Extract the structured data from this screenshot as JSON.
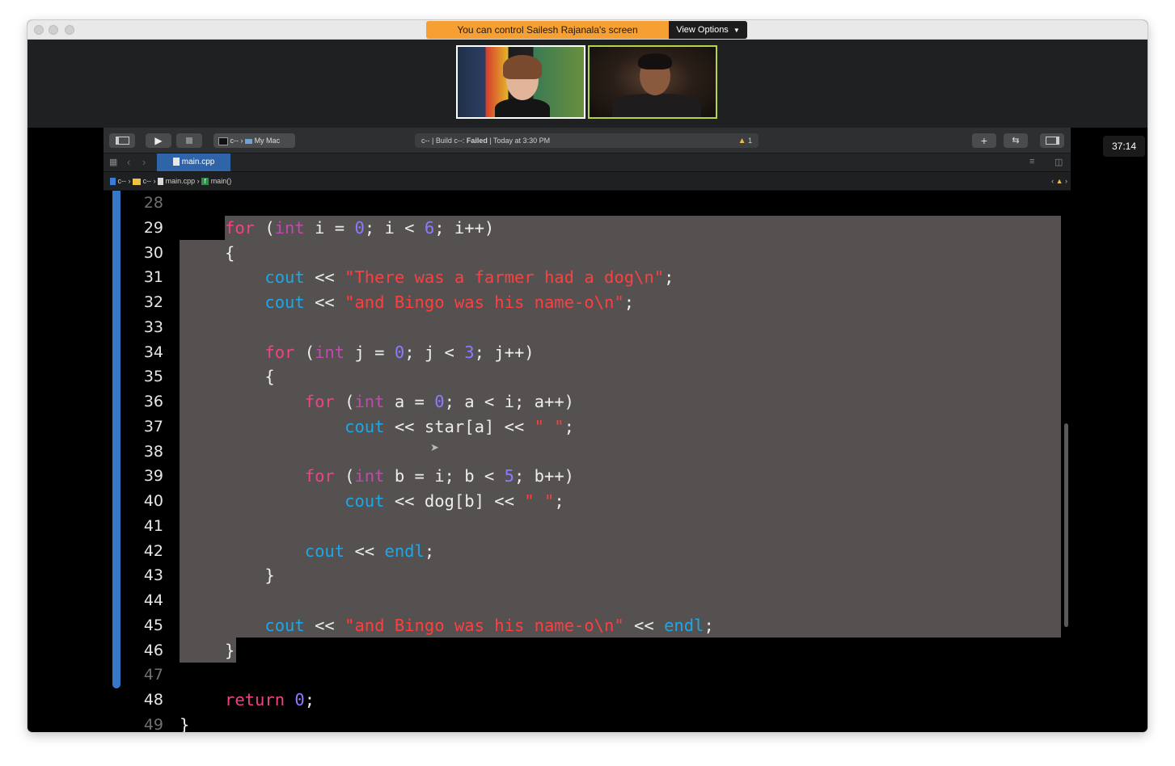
{
  "zoom": {
    "banner": "You can control Sailesh Rajanala's screen",
    "view_options": "View Options",
    "timer": "37:14"
  },
  "xcode": {
    "scheme": "c--",
    "destination": "My Mac",
    "status_prefix": "c-- | Build c--: ",
    "status_result": "Failed",
    "status_time": " | Today at 3:30 PM",
    "warning_count": "1",
    "tab_label": "main.cpp",
    "breadcrumb": [
      "c--",
      "c--",
      "main.cpp",
      "main()"
    ],
    "selection_color": "#545150",
    "accent_color": "#3478c6"
  },
  "code_lines": [
    {
      "n": "28",
      "code": []
    },
    {
      "n": "29",
      "code": [
        [
          "for",
          "kw"
        ],
        [
          " (",
          ""
        ],
        [
          "int",
          "ty"
        ],
        [
          " i = ",
          ""
        ],
        [
          "0",
          "num"
        ],
        [
          "; i < ",
          ""
        ],
        [
          "6",
          "num"
        ],
        [
          "; i++)",
          ""
        ]
      ]
    },
    {
      "n": "30",
      "code": [
        [
          "{",
          ""
        ]
      ]
    },
    {
      "n": "31",
      "code": [
        [
          "    ",
          ""
        ],
        [
          "cout",
          "fn"
        ],
        [
          " << ",
          ""
        ],
        [
          "\"There was a farmer had a dog\\n\"",
          "str"
        ],
        [
          ";",
          ""
        ]
      ]
    },
    {
      "n": "32",
      "code": [
        [
          "    ",
          ""
        ],
        [
          "cout",
          "fn"
        ],
        [
          " << ",
          ""
        ],
        [
          "\"and Bingo was his name-o\\n\"",
          "str"
        ],
        [
          ";",
          ""
        ]
      ]
    },
    {
      "n": "33",
      "code": []
    },
    {
      "n": "34",
      "code": [
        [
          "    ",
          ""
        ],
        [
          "for",
          "kw"
        ],
        [
          " (",
          ""
        ],
        [
          "int",
          "ty"
        ],
        [
          " j = ",
          ""
        ],
        [
          "0",
          "num"
        ],
        [
          "; j < ",
          ""
        ],
        [
          "3",
          "num"
        ],
        [
          "; j++)",
          ""
        ]
      ]
    },
    {
      "n": "35",
      "code": [
        [
          "    {",
          ""
        ]
      ]
    },
    {
      "n": "36",
      "code": [
        [
          "        ",
          ""
        ],
        [
          "for",
          "kw"
        ],
        [
          " (",
          ""
        ],
        [
          "int",
          "ty"
        ],
        [
          " a = ",
          ""
        ],
        [
          "0",
          "num"
        ],
        [
          "; a < i; a++)",
          ""
        ]
      ]
    },
    {
      "n": "37",
      "code": [
        [
          "            ",
          ""
        ],
        [
          "cout",
          "fn"
        ],
        [
          " << star[a] << ",
          ""
        ],
        [
          "\" \"",
          "str"
        ],
        [
          ";",
          ""
        ]
      ]
    },
    {
      "n": "38",
      "code": []
    },
    {
      "n": "39",
      "code": [
        [
          "        ",
          ""
        ],
        [
          "for",
          "kw"
        ],
        [
          " (",
          ""
        ],
        [
          "int",
          "ty"
        ],
        [
          " b = i; b < ",
          ""
        ],
        [
          "5",
          "num"
        ],
        [
          "; b++)",
          ""
        ]
      ]
    },
    {
      "n": "40",
      "code": [
        [
          "            ",
          ""
        ],
        [
          "cout",
          "fn"
        ],
        [
          " << dog[b] << ",
          ""
        ],
        [
          "\" \"",
          "str"
        ],
        [
          ";",
          ""
        ]
      ]
    },
    {
      "n": "41",
      "code": []
    },
    {
      "n": "42",
      "code": [
        [
          "        ",
          ""
        ],
        [
          "cout",
          "fn"
        ],
        [
          " << ",
          ""
        ],
        [
          "endl",
          "fn"
        ],
        [
          ";",
          ""
        ]
      ]
    },
    {
      "n": "43",
      "code": [
        [
          "    }",
          ""
        ]
      ]
    },
    {
      "n": "44",
      "code": []
    },
    {
      "n": "45",
      "code": [
        [
          "    ",
          ""
        ],
        [
          "cout",
          "fn"
        ],
        [
          " << ",
          ""
        ],
        [
          "\"and Bingo was his name-o\\n\"",
          "str"
        ],
        [
          " << ",
          ""
        ],
        [
          "endl",
          "fn"
        ],
        [
          ";",
          ""
        ]
      ]
    },
    {
      "n": "46",
      "code": [
        [
          "}",
          ""
        ]
      ]
    },
    {
      "n": "47",
      "code": []
    },
    {
      "n": "48",
      "code": [
        [
          "return",
          "kw"
        ],
        [
          " ",
          ""
        ],
        [
          "0",
          "num"
        ],
        [
          ";",
          ""
        ]
      ]
    },
    {
      "n": "49",
      "code": [
        [
          "}",
          ""
        ]
      ]
    }
  ]
}
